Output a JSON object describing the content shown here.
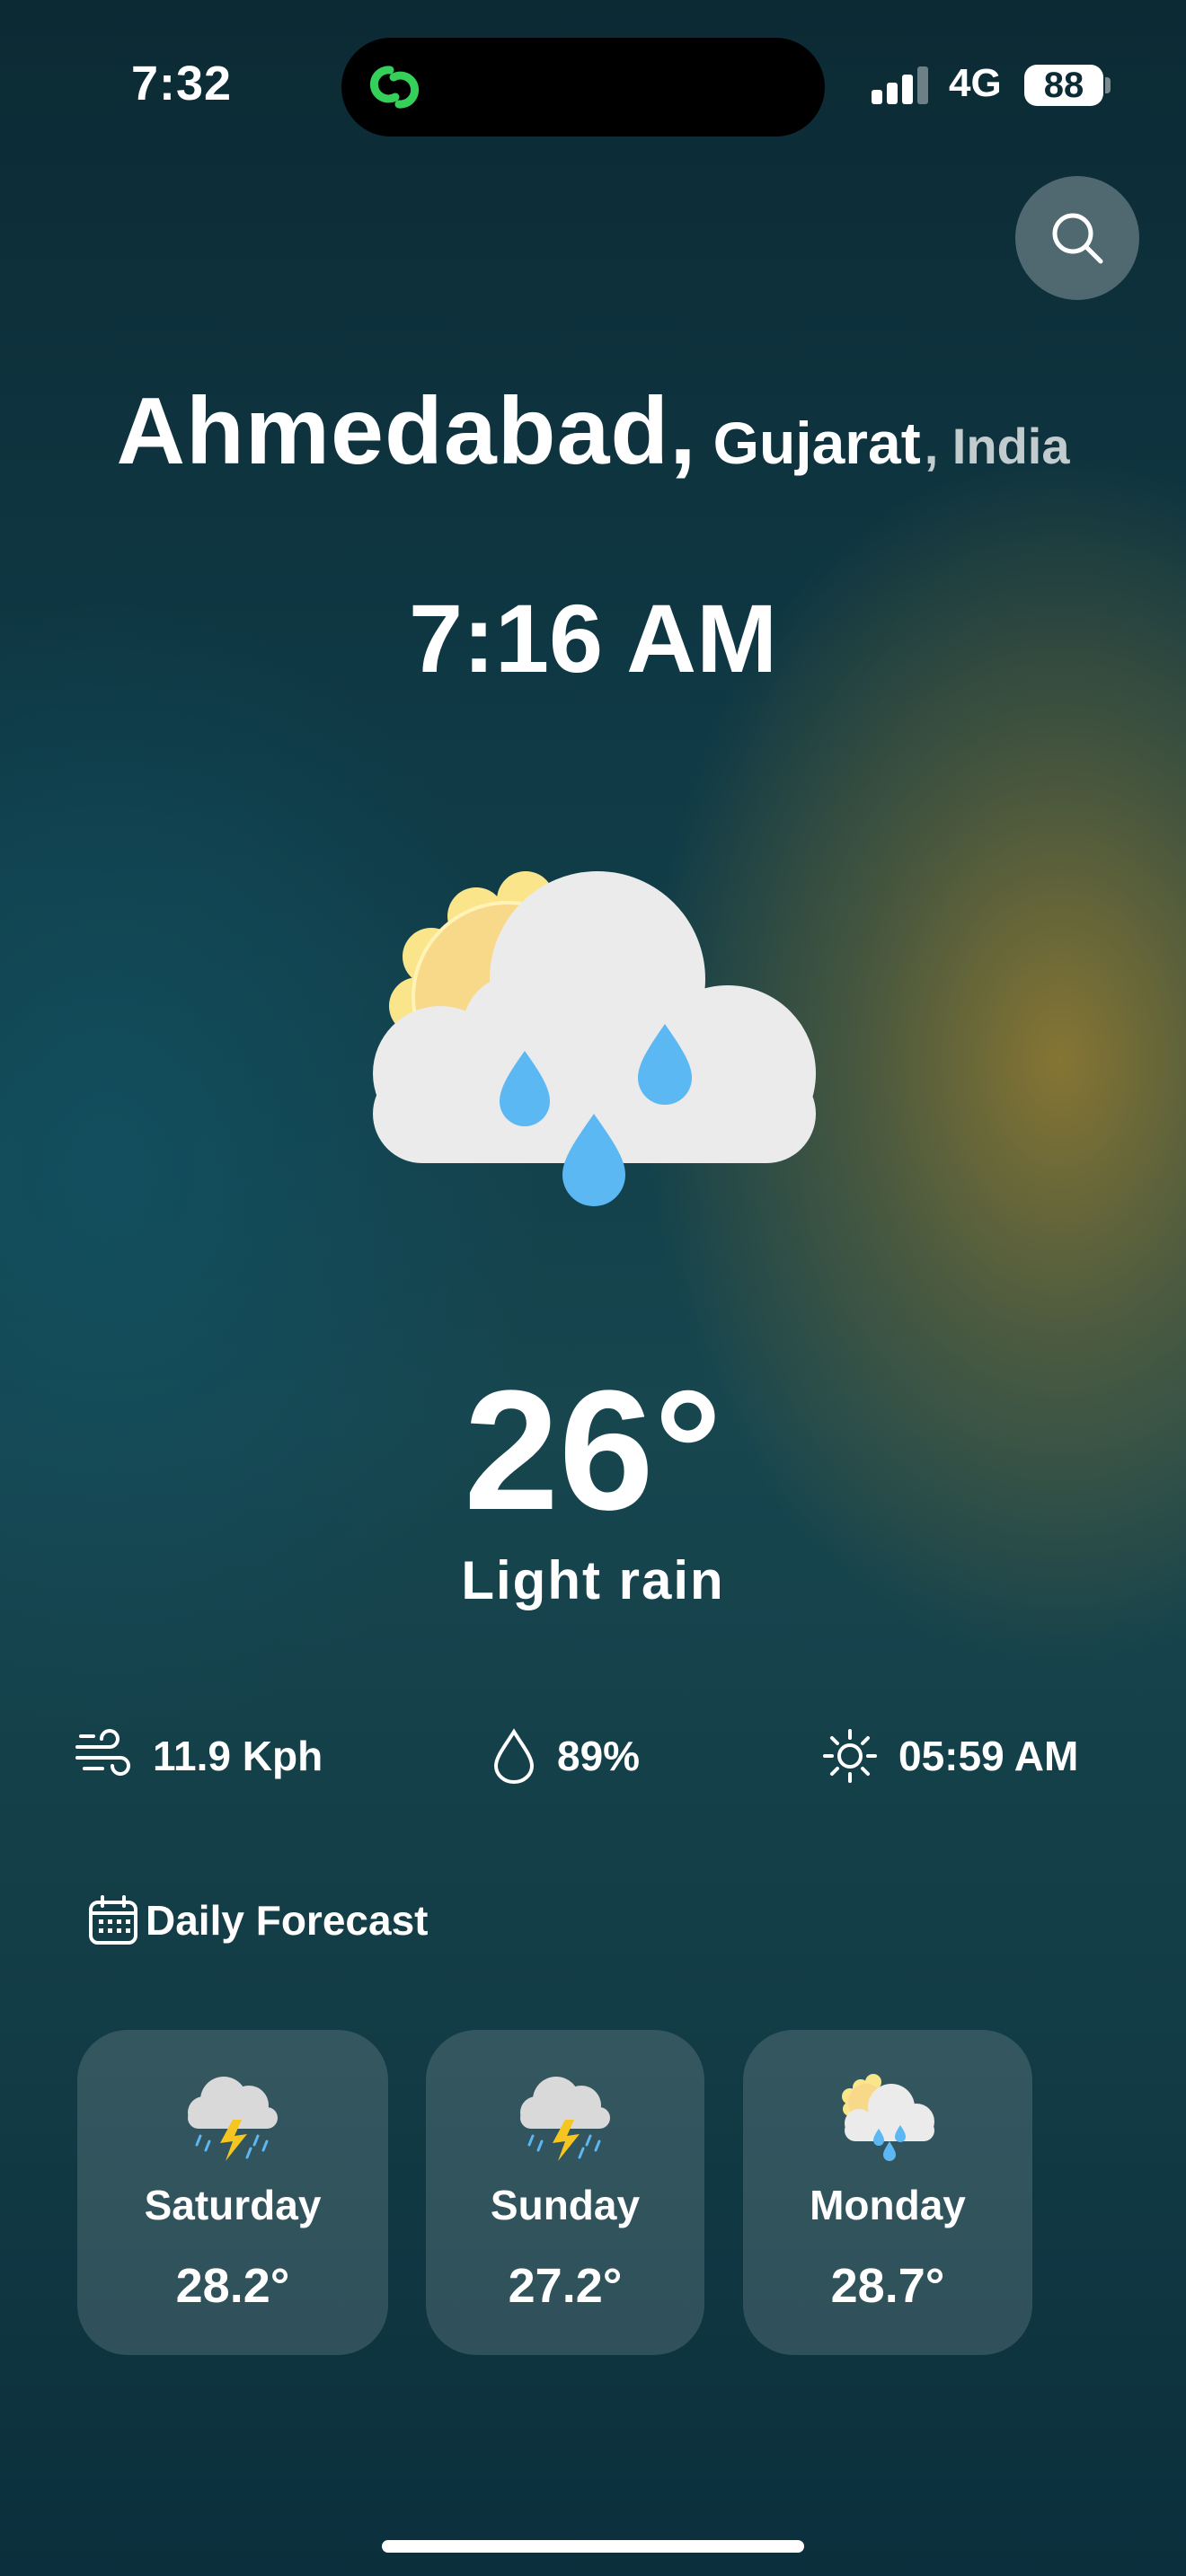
{
  "status_bar": {
    "time": "7:32",
    "network": "4G",
    "battery": "88"
  },
  "location": {
    "city": "Ahmedabad,",
    "state": "Gujarat",
    "country": ", India"
  },
  "local_time": "7:16 AM",
  "current": {
    "temperature": "26°",
    "condition": "Light rain",
    "icon": "partly-cloudy-rain-icon"
  },
  "metrics": {
    "wind": "11.9 Kph",
    "humidity": "89%",
    "sunrise": "05:59 AM"
  },
  "forecast": {
    "heading": "Daily Forecast",
    "days": [
      {
        "day": "Saturday",
        "temp": "28.2°",
        "icon": "thunderstorm-rain-icon"
      },
      {
        "day": "Sunday",
        "temp": "27.2°",
        "icon": "thunderstorm-rain-icon"
      },
      {
        "day": "Monday",
        "temp": "28.7°",
        "icon": "partly-cloudy-rain-icon"
      }
    ]
  },
  "colors": {
    "accent_green": "#35d05a",
    "rain_blue": "#5bb8f2",
    "sun_yellow": "#f8d98a"
  }
}
